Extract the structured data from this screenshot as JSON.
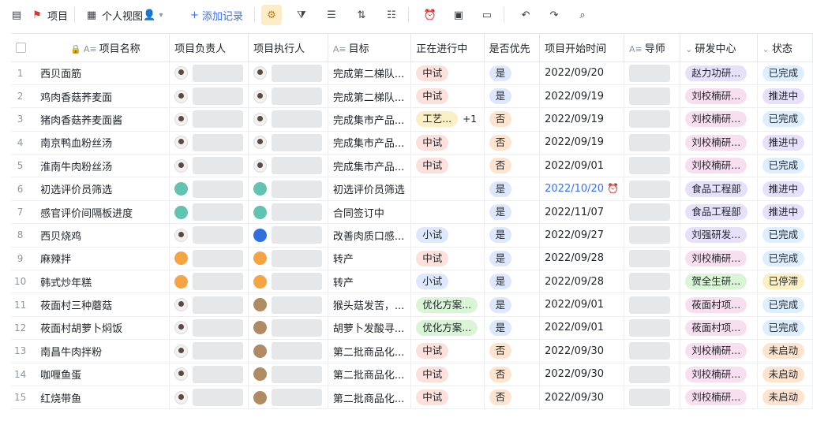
{
  "toolbar": {
    "project_label": "项目",
    "view_label": "个人视图",
    "add_label": "添加记录"
  },
  "columns": [
    "项目名称",
    "项目负责人",
    "项目执行人",
    "目标",
    "正在进行中",
    "是否优先",
    "项目开始时间",
    "导师",
    "研发中心",
    "状态"
  ],
  "rows": [
    {
      "num": "1",
      "name": "西贝面筋",
      "owner": "person",
      "exec": "person",
      "goal": "完成第二梯队...",
      "progress": [
        {
          "t": "中试",
          "c": "t-red"
        }
      ],
      "prio": "是",
      "date": "2022/09/20",
      "center": {
        "t": "赵力功研...",
        "c": "t-purple"
      },
      "status": {
        "t": "已完成",
        "c": "t-lblue"
      }
    },
    {
      "num": "2",
      "name": "鸡肉香菇荞麦面",
      "owner": "person",
      "exec": "person",
      "goal": "完成第二梯队...",
      "progress": [
        {
          "t": "中试",
          "c": "t-red"
        }
      ],
      "prio": "是",
      "date": "2022/09/19",
      "center": {
        "t": "刘校楠研...",
        "c": "t-pink"
      },
      "status": {
        "t": "推进中",
        "c": "t-purple"
      }
    },
    {
      "num": "3",
      "name": "猪肉香菇荞麦面酱",
      "owner": "person",
      "exec": "person",
      "goal": "完成集市产品...",
      "progress": [
        {
          "t": "工艺...",
          "c": "t-yellow"
        }
      ],
      "more": "+1",
      "prio": "否",
      "date": "2022/09/19",
      "center": {
        "t": "刘校楠研...",
        "c": "t-pink"
      },
      "status": {
        "t": "已完成",
        "c": "t-lblue"
      }
    },
    {
      "num": "4",
      "name": "南京鸭血粉丝汤",
      "owner": "person",
      "exec": "person",
      "goal": "完成集市产品...",
      "progress": [
        {
          "t": "中试",
          "c": "t-red"
        }
      ],
      "prio": "否",
      "date": "2022/09/19",
      "center": {
        "t": "刘校楠研...",
        "c": "t-pink"
      },
      "status": {
        "t": "推进中",
        "c": "t-purple"
      }
    },
    {
      "num": "5",
      "name": "淮南牛肉粉丝汤",
      "owner": "person",
      "exec": "person",
      "goal": "完成集市产品...",
      "progress": [
        {
          "t": "中试",
          "c": "t-red"
        }
      ],
      "prio": "否",
      "date": "2022/09/01",
      "center": {
        "t": "刘校楠研...",
        "c": "t-pink"
      },
      "status": {
        "t": "已完成",
        "c": "t-lblue"
      }
    },
    {
      "num": "6",
      "name": "初选评价员筛选",
      "owner": "teal",
      "exec": "teal",
      "goal": "初选评价员筛选",
      "progress": [],
      "prio": "是",
      "date": "2022/10/20",
      "datehl": true,
      "center": {
        "t": "食品工程部",
        "c": "t-purple"
      },
      "status": {
        "t": "推进中",
        "c": "t-purple"
      }
    },
    {
      "num": "7",
      "name": "感官评价间隔板进度",
      "owner": "teal",
      "exec": "teal",
      "goal": "合同签订中",
      "progress": [],
      "prio": "是",
      "date": "2022/11/07",
      "center": {
        "t": "食品工程部",
        "c": "t-purple"
      },
      "status": {
        "t": "推进中",
        "c": "t-purple"
      }
    },
    {
      "num": "8",
      "name": "西贝烧鸡",
      "owner": "person",
      "exec": "blue",
      "goal": "改善肉质口感...",
      "progress": [
        {
          "t": "小试",
          "c": "t-blue"
        }
      ],
      "prio": "是",
      "date": "2022/09/27",
      "center": {
        "t": "刘强研发...",
        "c": "t-purple"
      },
      "status": {
        "t": "已完成",
        "c": "t-lblue"
      }
    },
    {
      "num": "9",
      "name": "麻辣拌",
      "owner": "orange",
      "exec": "orange",
      "goal": "转产",
      "progress": [
        {
          "t": "中试",
          "c": "t-red"
        }
      ],
      "prio": "是",
      "date": "2022/09/28",
      "center": {
        "t": "刘校楠研...",
        "c": "t-pink"
      },
      "status": {
        "t": "已完成",
        "c": "t-lblue"
      }
    },
    {
      "num": "10",
      "name": "韩式炒年糕",
      "owner": "orange",
      "exec": "orange",
      "goal": "转产",
      "progress": [
        {
          "t": "小试",
          "c": "t-blue"
        }
      ],
      "prio": "是",
      "date": "2022/09/28",
      "center": {
        "t": "贺全生研...",
        "c": "t-green"
      },
      "status": {
        "t": "已停滞",
        "c": "t-yellow"
      }
    },
    {
      "num": "11",
      "name": "莜面村三种蘑菇",
      "owner": "person",
      "exec": "brown",
      "goal": "猴头菇发苦，...",
      "progress": [
        {
          "t": "优化方案...",
          "c": "t-green"
        }
      ],
      "prio": "是",
      "date": "2022/09/01",
      "center": {
        "t": "莜面村项...",
        "c": "t-pink"
      },
      "status": {
        "t": "已完成",
        "c": "t-lblue"
      }
    },
    {
      "num": "12",
      "name": "莜面村胡萝卜焖饭",
      "owner": "person",
      "exec": "brown",
      "goal": "胡萝卜发酸寻...",
      "progress": [
        {
          "t": "优化方案...",
          "c": "t-green"
        }
      ],
      "prio": "是",
      "date": "2022/09/01",
      "center": {
        "t": "莜面村项...",
        "c": "t-pink"
      },
      "status": {
        "t": "已完成",
        "c": "t-lblue"
      }
    },
    {
      "num": "13",
      "name": "南昌牛肉拌粉",
      "owner": "person",
      "exec": "brown",
      "goal": "第二批商品化...",
      "progress": [
        {
          "t": "中试",
          "c": "t-red"
        }
      ],
      "prio": "否",
      "date": "2022/09/30",
      "center": {
        "t": "刘校楠研...",
        "c": "t-pink"
      },
      "status": {
        "t": "未启动",
        "c": "t-orange"
      }
    },
    {
      "num": "14",
      "name": "咖喱鱼蛋",
      "owner": "person",
      "exec": "brown",
      "goal": "第二批商品化...",
      "progress": [
        {
          "t": "中试",
          "c": "t-red"
        }
      ],
      "prio": "否",
      "date": "2022/09/30",
      "center": {
        "t": "刘校楠研...",
        "c": "t-pink"
      },
      "status": {
        "t": "未启动",
        "c": "t-orange"
      }
    },
    {
      "num": "15",
      "name": "红烧带鱼",
      "owner": "person",
      "exec": "brown",
      "goal": "第二批商品化...",
      "progress": [
        {
          "t": "中试",
          "c": "t-red"
        }
      ],
      "prio": "否",
      "date": "2022/09/30",
      "center": {
        "t": "刘校楠研...",
        "c": "t-pink"
      },
      "status": {
        "t": "未启动",
        "c": "t-orange"
      }
    }
  ]
}
